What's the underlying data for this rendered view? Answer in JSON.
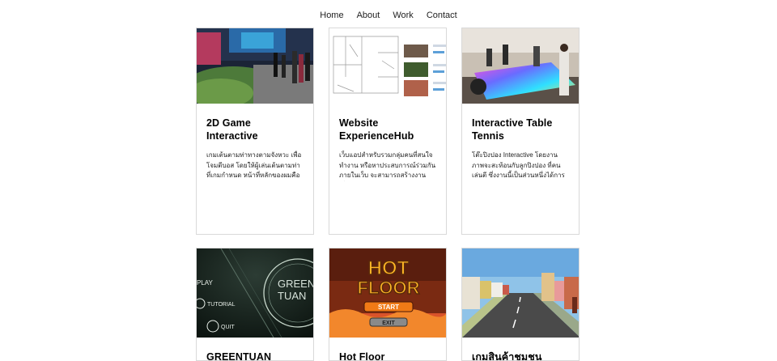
{
  "nav": {
    "items": [
      "Home",
      "About",
      "Work",
      "Contact"
    ]
  },
  "cards": [
    {
      "title": "2D Game Interactive",
      "desc": "เกมเต้นตามท่าทางตามจังหวะ เพื่อโจมตีบอส โดยให้ผู้เล่นเต้นตามท่าที่เกมกำหนด หน้าที่หลักของผมคือก..."
    },
    {
      "title": "Website ExperienceHub",
      "desc": "เว็บแอปสำหรับรวมกลุ่มคนที่สนใจทำงาน หรือหาประสบการณ์ร่วมกันภายในเว็บ จะสามารถสร้างงานเพื่อ..."
    },
    {
      "title": "Interactive Table Tennis",
      "desc": "โต๊ะปิงปอง Interactive โดยงานภาพจะสะท้อนกับลูกปิงปอง ที่คนเล่นตี ซึ่งงานนี้เป็นส่วนหนึ่งได้การแสดงโชว์..."
    },
    {
      "title": "GREENTUAN",
      "thumb_text": {
        "play": "PLAY",
        "tutorial": "TUTORIAL",
        "quit": "QUIT",
        "logo1": "GREEN",
        "logo2": "TUAN"
      }
    },
    {
      "title": "Hot Floor",
      "thumb_text": {
        "logo1": "HOT",
        "logo2": "FLOOR",
        "start": "START",
        "exit": "EXIT"
      }
    },
    {
      "title": "เกมสินค้าชุมชนออน..."
    }
  ]
}
